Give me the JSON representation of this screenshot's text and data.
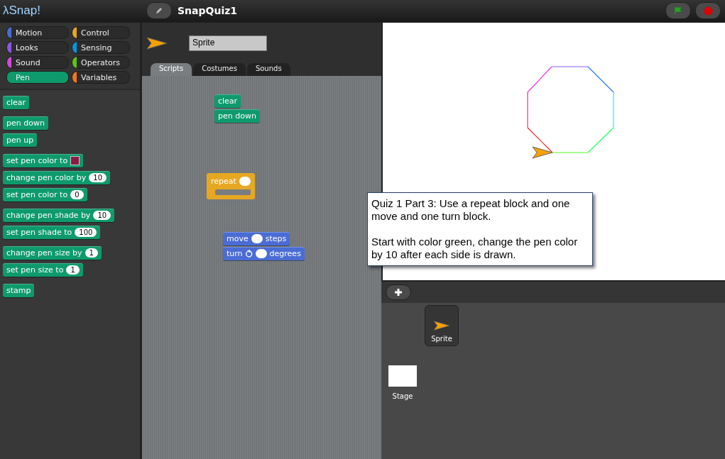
{
  "top_bar": {
    "logo": "λSnap!",
    "project_title": "SnapQuiz1"
  },
  "categories": [
    {
      "label": "Motion",
      "color": "#4a6cd4",
      "selected": false
    },
    {
      "label": "Control",
      "color": "#e6a822",
      "selected": false
    },
    {
      "label": "Looks",
      "color": "#8f56e3",
      "selected": false
    },
    {
      "label": "Sensing",
      "color": "#0494dc",
      "selected": false
    },
    {
      "label": "Sound",
      "color": "#cf4ad9",
      "selected": false
    },
    {
      "label": "Operators",
      "color": "#62c213",
      "selected": false
    },
    {
      "label": "Pen",
      "color": "#0e9a6c",
      "selected": true
    },
    {
      "label": "Variables",
      "color": "#f3761d",
      "selected": false
    }
  ],
  "palette": [
    [
      {
        "kind": "pen",
        "parts": [
          {
            "kind": "text",
            "text": "clear"
          }
        ]
      }
    ],
    [
      {
        "kind": "pen",
        "parts": [
          {
            "kind": "text",
            "text": "pen down"
          }
        ]
      },
      {
        "kind": "pen",
        "parts": [
          {
            "kind": "text",
            "text": "pen up"
          }
        ]
      }
    ],
    [
      {
        "kind": "pen",
        "parts": [
          {
            "kind": "text",
            "text": "set pen color to"
          },
          {
            "kind": "color",
            "color": "#8b1a45"
          }
        ]
      },
      {
        "kind": "pen",
        "parts": [
          {
            "kind": "text",
            "text": "change pen color by"
          },
          {
            "kind": "number",
            "text": "10"
          }
        ]
      },
      {
        "kind": "pen",
        "parts": [
          {
            "kind": "text",
            "text": "set pen color to"
          },
          {
            "kind": "number",
            "text": "0"
          }
        ]
      }
    ],
    [
      {
        "kind": "pen",
        "parts": [
          {
            "kind": "text",
            "text": "change pen shade by"
          },
          {
            "kind": "number",
            "text": "10"
          }
        ]
      },
      {
        "kind": "pen",
        "parts": [
          {
            "kind": "text",
            "text": "set pen shade to"
          },
          {
            "kind": "number",
            "text": "100"
          }
        ]
      }
    ],
    [
      {
        "kind": "pen",
        "parts": [
          {
            "kind": "text",
            "text": "change pen size by"
          },
          {
            "kind": "number",
            "text": "1"
          }
        ]
      },
      {
        "kind": "pen",
        "parts": [
          {
            "kind": "text",
            "text": "set pen size to"
          },
          {
            "kind": "number",
            "text": "1"
          }
        ]
      }
    ],
    [
      {
        "kind": "pen",
        "parts": [
          {
            "kind": "text",
            "text": "stamp"
          }
        ]
      }
    ]
  ],
  "sprite": {
    "name": "Sprite"
  },
  "tabs": [
    {
      "label": "Scripts",
      "selected": true
    },
    {
      "label": "Costumes",
      "selected": false
    },
    {
      "label": "Sounds",
      "selected": false
    }
  ],
  "scripts": [
    [
      {
        "kind": "pen",
        "parts": [
          {
            "kind": "text",
            "text": "clear"
          }
        ]
      },
      {
        "kind": "pen",
        "parts": [
          {
            "kind": "text",
            "text": "pen down"
          }
        ]
      }
    ],
    [
      {
        "kind": "loop",
        "parts": [
          {
            "kind": "text",
            "text": "repeat"
          },
          {
            "kind": "slot"
          }
        ]
      }
    ],
    [
      {
        "kind": "motion",
        "parts": [
          {
            "kind": "text",
            "text": "move"
          },
          {
            "kind": "slot"
          },
          {
            "kind": "text",
            "text": "steps"
          }
        ]
      },
      {
        "kind": "motion",
        "parts": [
          {
            "kind": "text",
            "text": "turn"
          },
          {
            "kind": "turn-icon"
          },
          {
            "kind": "slot"
          },
          {
            "kind": "text",
            "text": "degrees"
          }
        ]
      }
    ]
  ],
  "note": {
    "paragraphs": [
      "Quiz 1 Part 3:  Use a repeat block and one move and one turn block.",
      "Start with color green, change the pen color by 10 after each side is drawn."
    ]
  },
  "corral": {
    "sprites": [
      {
        "name": "Sprite"
      }
    ],
    "stage_label": "Stage"
  }
}
